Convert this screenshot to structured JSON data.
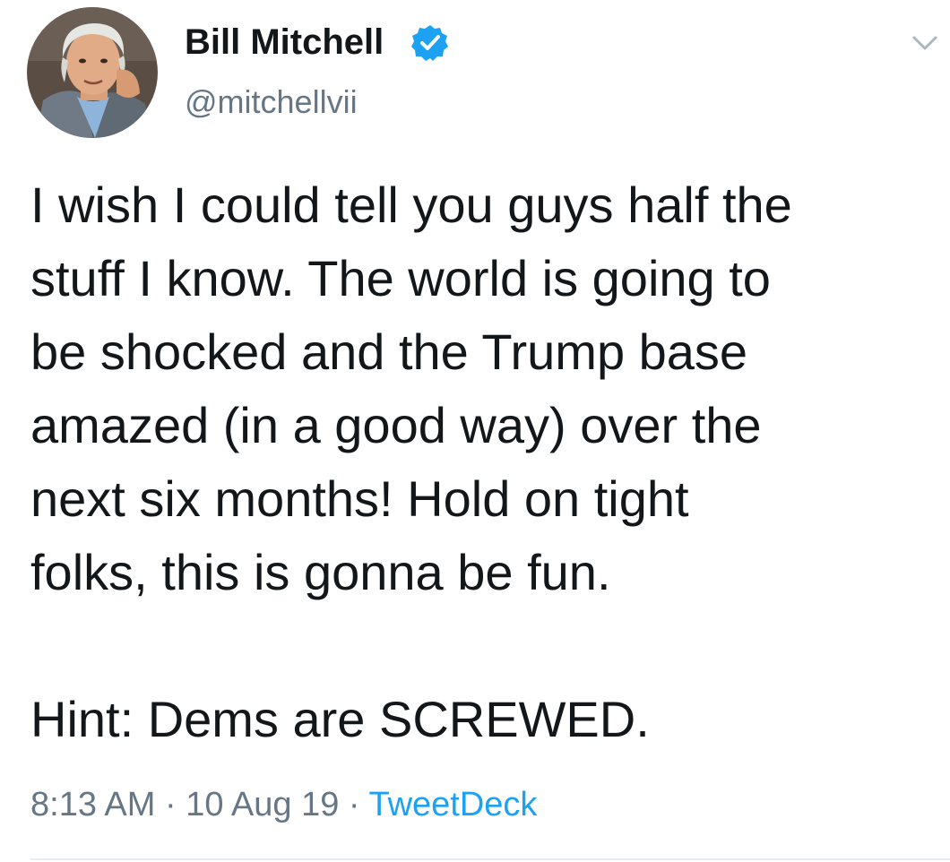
{
  "author": {
    "display_name": "Bill Mitchell",
    "handle": "@mitchellvii",
    "verified": true,
    "verified_icon": "verified-badge-icon",
    "avatar_icon": "profile-photo"
  },
  "tweet": {
    "text": "I wish I could tell you guys half the\nstuff I know.  The world is going to\nbe shocked and the Trump base\namazed (in a good way) over the\nnext six months!  Hold on tight\nfolks, this is gonna be fun.\n\nHint: Dems are SCREWED."
  },
  "meta": {
    "time": "8:13 AM",
    "separator": " · ",
    "date": "10 Aug 19",
    "source": "TweetDeck"
  },
  "colors": {
    "text": "#14171a",
    "secondary": "#657786",
    "link": "#1da1f2",
    "verified": "#1da1f2",
    "divider": "#e6ecf0"
  },
  "menu": {
    "icon": "chevron-down-icon"
  }
}
